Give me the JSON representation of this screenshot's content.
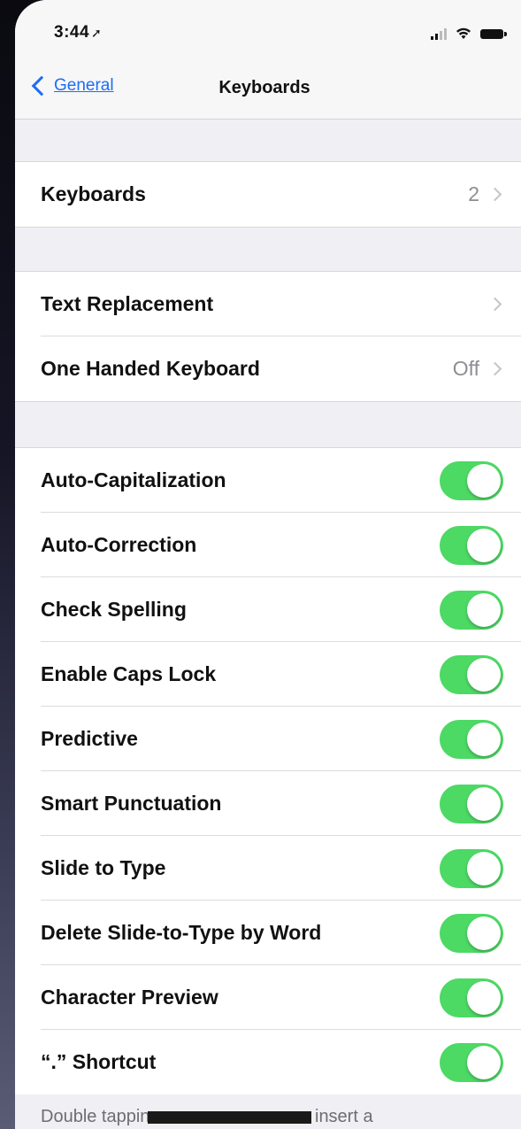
{
  "status": {
    "time": "3:44",
    "location_icon": "location-arrow-icon",
    "signal_icon": "cellular-signal-icon",
    "wifi_icon": "wifi-icon",
    "battery_icon": "battery-icon"
  },
  "nav": {
    "back_label": "General",
    "title": "Keyboards"
  },
  "group1": [
    {
      "label": "Keyboards",
      "value": "2"
    }
  ],
  "group2": [
    {
      "label": "Text Replacement",
      "value": ""
    },
    {
      "label": "One Handed Keyboard",
      "value": "Off"
    }
  ],
  "toggles": [
    {
      "label": "Auto-Capitalization",
      "on": true
    },
    {
      "label": "Auto-Correction",
      "on": true
    },
    {
      "label": "Check Spelling",
      "on": true
    },
    {
      "label": "Enable Caps Lock",
      "on": true
    },
    {
      "label": "Predictive",
      "on": true
    },
    {
      "label": "Smart Punctuation",
      "on": true
    },
    {
      "label": "Slide to Type",
      "on": true
    },
    {
      "label": "Delete Slide-to-Type by Word",
      "on": true
    },
    {
      "label": "Character Preview",
      "on": true
    },
    {
      "label": "“.” Shortcut",
      "on": true
    }
  ],
  "footer": {
    "text_before": "Double tappin",
    "text_after": " insert a"
  },
  "colors": {
    "toggle_on": "#4cd964",
    "link": "#1a6ef5",
    "background": "#efeff4"
  }
}
